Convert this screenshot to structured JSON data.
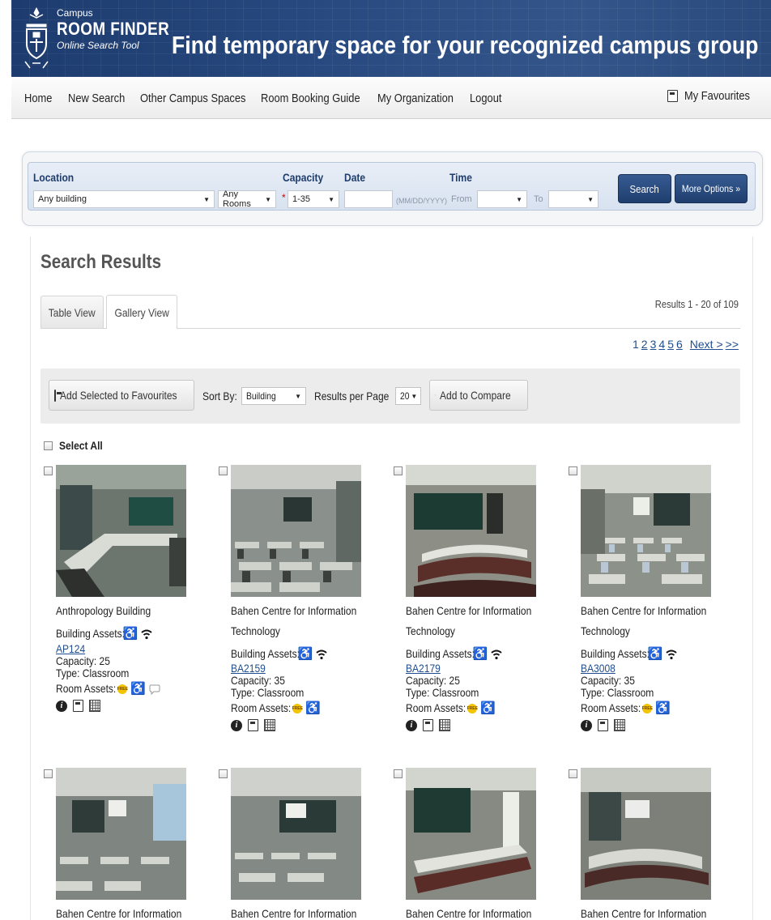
{
  "header": {
    "logo_small": "Campus",
    "logo_big": "ROOM FINDER",
    "logo_sub": "Online Search Tool",
    "title": "Find temporary space for your recognized campus group"
  },
  "nav": {
    "items": [
      "Home",
      "New Search",
      "Other Campus Spaces",
      "Room Booking Guide",
      "My Organization",
      "Logout"
    ],
    "favourites": "My Favourites"
  },
  "search": {
    "location_label": "Location",
    "building_value": "Any building",
    "rooms_value": "Any Rooms",
    "capacity_label": "Capacity",
    "capacity_value": "1-35",
    "date_label": "Date",
    "date_value": "",
    "date_hint": "(MM/DD/YYYY)",
    "time_label": "Time",
    "from_label": "From",
    "from_value": "",
    "to_label": "To",
    "to_value": "",
    "search_button": "Search",
    "more_options_button": "More Options »"
  },
  "results": {
    "title": "Search Results",
    "tabs": [
      {
        "label": "Table View"
      },
      {
        "label": "Gallery View"
      }
    ],
    "count_text": "Results 1 - 20 of 109",
    "pager": {
      "current": "1",
      "pages": [
        "2",
        "3",
        "4",
        "5",
        "6"
      ],
      "next": "Next >",
      "last": ">>"
    },
    "toolbar": {
      "add_favourites": "Add Selected to Favourites",
      "sort_label": "Sort By:",
      "sort_value": "Building",
      "per_page_label": "Results per Page",
      "per_page_value": "20",
      "compare": "Add to Compare"
    },
    "select_all": "Select All",
    "cards": [
      {
        "building": "Anthropology Building",
        "building_assets_label": "Building Assets:",
        "room": "AP124",
        "capacity": "Capacity: 25",
        "type": "Type: Classroom",
        "room_assets_label": "Room Assets:"
      },
      {
        "building": "Bahen Centre for Information Technology",
        "building_assets_label": "Building Assets:",
        "room": "BA2159",
        "capacity": "Capacity: 35",
        "type": "Type: Classroom",
        "room_assets_label": "Room Assets:"
      },
      {
        "building": "Bahen Centre for Information Technology",
        "building_assets_label": "Building Assets:",
        "room": "BA2179",
        "capacity": "Capacity: 25",
        "type": "Type: Classroom",
        "room_assets_label": "Room Assets:"
      },
      {
        "building": "Bahen Centre for Information Technology",
        "building_assets_label": "Building Assets:",
        "room": "BA3008",
        "capacity": "Capacity: 35",
        "type": "Type: Classroom",
        "room_assets_label": "Room Assets:"
      },
      {
        "building": "Bahen Centre for Information"
      },
      {
        "building": "Bahen Centre for Information"
      },
      {
        "building": "Bahen Centre for Information"
      },
      {
        "building": "Bahen Centre for Information"
      }
    ]
  }
}
